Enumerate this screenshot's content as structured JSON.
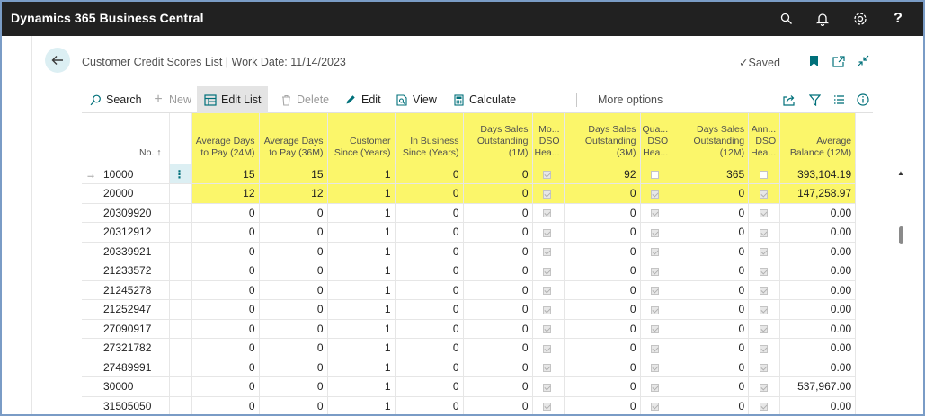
{
  "app": {
    "title": "Dynamics 365 Business Central"
  },
  "topbar_icons": [
    "search-icon",
    "bell-icon",
    "gear-icon",
    "help-icon"
  ],
  "page": {
    "title": "Customer Credit Scores List | Work Date: 11/14/2023",
    "saved_label": "Saved"
  },
  "actions": {
    "search": "Search",
    "new": "New",
    "edit_list": "Edit List",
    "delete": "Delete",
    "edit": "Edit",
    "view": "View",
    "calculate": "Calculate",
    "more_options": "More options"
  },
  "colors": {
    "highlight": "#fbf66a",
    "accent": "#00707a",
    "topbar": "#212121"
  },
  "columns": [
    {
      "key": "no",
      "label": "No. ↑"
    },
    {
      "key": "adp24",
      "label": "Average Days to Pay (24M)"
    },
    {
      "key": "adp36",
      "label": "Average Days to Pay (36M)"
    },
    {
      "key": "since",
      "label": "Customer Since (Years)"
    },
    {
      "key": "biz",
      "label": "In Business Since (Years)"
    },
    {
      "key": "dso1",
      "label": "Days Sales Outstanding (1M)"
    },
    {
      "key": "mo",
      "label": "Mo... DSO Hea..."
    },
    {
      "key": "dso3",
      "label": "Days Sales Outstanding (3M)"
    },
    {
      "key": "qua",
      "label": "Qua... DSO Hea..."
    },
    {
      "key": "dso12",
      "label": "Days Sales Outstanding (12M)"
    },
    {
      "key": "ann",
      "label": "Ann... DSO Hea..."
    },
    {
      "key": "bal",
      "label": "Average Balance (12M)"
    }
  ],
  "rows": [
    {
      "no": "10000",
      "adp24": "15",
      "adp36": "15",
      "since": "1",
      "biz": "0",
      "dso1": "0",
      "mo": true,
      "dso3": "92",
      "qua": false,
      "dso12": "365",
      "ann": false,
      "bal": "393,104.19"
    },
    {
      "no": "20000",
      "adp24": "12",
      "adp36": "12",
      "since": "1",
      "biz": "0",
      "dso1": "0",
      "mo": true,
      "dso3": "0",
      "qua": true,
      "dso12": "0",
      "ann": true,
      "bal": "147,258.97"
    },
    {
      "no": "20309920",
      "adp24": "0",
      "adp36": "0",
      "since": "1",
      "biz": "0",
      "dso1": "0",
      "mo": true,
      "dso3": "0",
      "qua": true,
      "dso12": "0",
      "ann": true,
      "bal": "0.00"
    },
    {
      "no": "20312912",
      "adp24": "0",
      "adp36": "0",
      "since": "1",
      "biz": "0",
      "dso1": "0",
      "mo": true,
      "dso3": "0",
      "qua": true,
      "dso12": "0",
      "ann": true,
      "bal": "0.00"
    },
    {
      "no": "20339921",
      "adp24": "0",
      "adp36": "0",
      "since": "1",
      "biz": "0",
      "dso1": "0",
      "mo": true,
      "dso3": "0",
      "qua": true,
      "dso12": "0",
      "ann": true,
      "bal": "0.00"
    },
    {
      "no": "21233572",
      "adp24": "0",
      "adp36": "0",
      "since": "1",
      "biz": "0",
      "dso1": "0",
      "mo": true,
      "dso3": "0",
      "qua": true,
      "dso12": "0",
      "ann": true,
      "bal": "0.00"
    },
    {
      "no": "21245278",
      "adp24": "0",
      "adp36": "0",
      "since": "1",
      "biz": "0",
      "dso1": "0",
      "mo": true,
      "dso3": "0",
      "qua": true,
      "dso12": "0",
      "ann": true,
      "bal": "0.00"
    },
    {
      "no": "21252947",
      "adp24": "0",
      "adp36": "0",
      "since": "1",
      "biz": "0",
      "dso1": "0",
      "mo": true,
      "dso3": "0",
      "qua": true,
      "dso12": "0",
      "ann": true,
      "bal": "0.00"
    },
    {
      "no": "27090917",
      "adp24": "0",
      "adp36": "0",
      "since": "1",
      "biz": "0",
      "dso1": "0",
      "mo": true,
      "dso3": "0",
      "qua": true,
      "dso12": "0",
      "ann": true,
      "bal": "0.00"
    },
    {
      "no": "27321782",
      "adp24": "0",
      "adp36": "0",
      "since": "1",
      "biz": "0",
      "dso1": "0",
      "mo": true,
      "dso3": "0",
      "qua": true,
      "dso12": "0",
      "ann": true,
      "bal": "0.00"
    },
    {
      "no": "27489991",
      "adp24": "0",
      "adp36": "0",
      "since": "1",
      "biz": "0",
      "dso1": "0",
      "mo": true,
      "dso3": "0",
      "qua": true,
      "dso12": "0",
      "ann": true,
      "bal": "0.00"
    },
    {
      "no": "30000",
      "adp24": "0",
      "adp36": "0",
      "since": "1",
      "biz": "0",
      "dso1": "0",
      "mo": true,
      "dso3": "0",
      "qua": true,
      "dso12": "0",
      "ann": true,
      "bal": "537,967.00"
    },
    {
      "no": "31505050",
      "adp24": "0",
      "adp36": "0",
      "since": "1",
      "biz": "0",
      "dso1": "0",
      "mo": true,
      "dso3": "0",
      "qua": true,
      "dso12": "0",
      "ann": true,
      "bal": "0.00"
    }
  ],
  "highlighted_rows": 2
}
